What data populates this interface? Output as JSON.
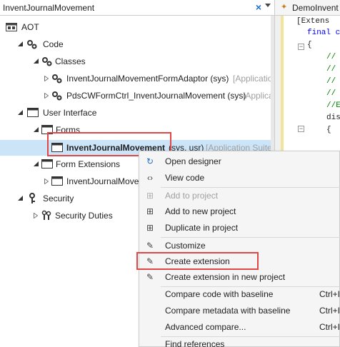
{
  "search": {
    "value": "InventJournalMovement",
    "clear_glyph": "×"
  },
  "tree": {
    "root": "AOT",
    "code": "Code",
    "classes": "Classes",
    "class1_name": "InventJournalMovementFormAdaptor (sys)",
    "class1_dim": "[Application",
    "class2_name": "PdsCWFormCtrl_InventJournalMovement (sys)",
    "class2_dim": "[Applica",
    "ui": "User Interface",
    "forms": "Forms",
    "form_name": "InventJournalMovement",
    "form_layers": "(sys, usr)",
    "form_dim": "[Application Suite",
    "form_ext": "Form Extensions",
    "form_ext_item": "InventJournalMove",
    "security": "Security",
    "security_duties": "Security Duties"
  },
  "editor": {
    "tab_label": "DemoInvent",
    "lines": [
      "[Extens",
      "final c",
      "{",
      "//",
      "//",
      "//",
      "//",
      "//E",
      "dis",
      "{"
    ]
  },
  "menu": {
    "open_designer": "Open designer",
    "view_code": "View code",
    "add_to_project": "Add to project",
    "add_to_new_project": "Add to new project",
    "duplicate_in_project": "Duplicate in project",
    "customize": "Customize",
    "create_extension": "Create extension",
    "create_extension_new_project": "Create extension in new project",
    "compare_code": "Compare code with baseline",
    "compare_code_shortcut": "Ctrl+I",
    "compare_metadata": "Compare metadata with baseline",
    "compare_metadata_shortcut": "Ctrl+I",
    "advanced_compare": "Advanced compare...",
    "advanced_compare_shortcut": "Ctrl+I",
    "find_references": "Find references"
  },
  "colors": {
    "highlight_border": "#e04848",
    "selection": "#cce4f7",
    "accent": "#1f6fc9"
  }
}
